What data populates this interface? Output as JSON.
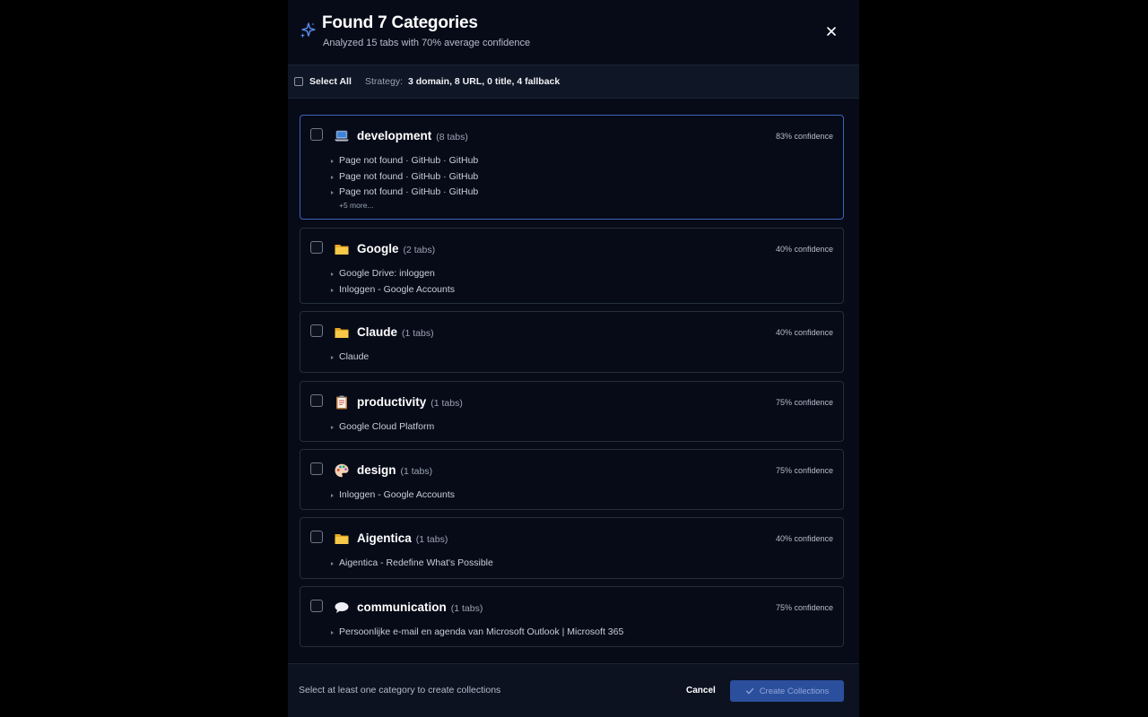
{
  "header": {
    "title": "Found 7 Categories",
    "subtitle": "Analyzed 15 tabs with 70% average confidence",
    "icon": "sparkles-icon",
    "close_icon": "close-icon"
  },
  "toolbar": {
    "select_all_label": "Select All",
    "strategy_label": "Strategy:",
    "strategy_value": "3 domain, 8 URL, 0 title, 4 fallback"
  },
  "categories": [
    {
      "name": "development",
      "count": "(8 tabs)",
      "confidence": "83% confidence",
      "icon": "laptop-icon",
      "tabs": [
        "Page not found · GitHub · GitHub",
        "Page not found · GitHub · GitHub",
        "Page not found · GitHub · GitHub"
      ],
      "more": "+5 more..."
    },
    {
      "name": "Google",
      "count": "(2 tabs)",
      "confidence": "40% confidence",
      "icon": "folder-icon",
      "tabs": [
        "Google Drive: inloggen",
        "Inloggen - Google Accounts"
      ]
    },
    {
      "name": "Claude",
      "count": "(1 tabs)",
      "confidence": "40% confidence",
      "icon": "folder-icon",
      "tabs": [
        "Claude"
      ]
    },
    {
      "name": "productivity",
      "count": "(1 tabs)",
      "confidence": "75% confidence",
      "icon": "clipboard-icon",
      "tabs": [
        "Google Cloud Platform"
      ]
    },
    {
      "name": "design",
      "count": "(1 tabs)",
      "confidence": "75% confidence",
      "icon": "palette-icon",
      "tabs": [
        "Inloggen - Google Accounts"
      ]
    },
    {
      "name": "Aigentica",
      "count": "(1 tabs)",
      "confidence": "40% confidence",
      "icon": "folder-icon",
      "tabs": [
        "Aigentica - Redefine What's Possible"
      ]
    },
    {
      "name": "communication",
      "count": "(1 tabs)",
      "confidence": "75% confidence",
      "icon": "speech-bubble-icon",
      "tabs": [
        "Persoonlijke e-mail en agenda van Microsoft Outlook | Microsoft 365"
      ]
    }
  ],
  "footer": {
    "hint": "Select at least one category to create collections",
    "cancel_label": "Cancel",
    "create_label": "Create Collections"
  },
  "colors": {
    "background": "#070b18",
    "accent": "#2b4f9c",
    "active_border": "#3e63b8"
  }
}
